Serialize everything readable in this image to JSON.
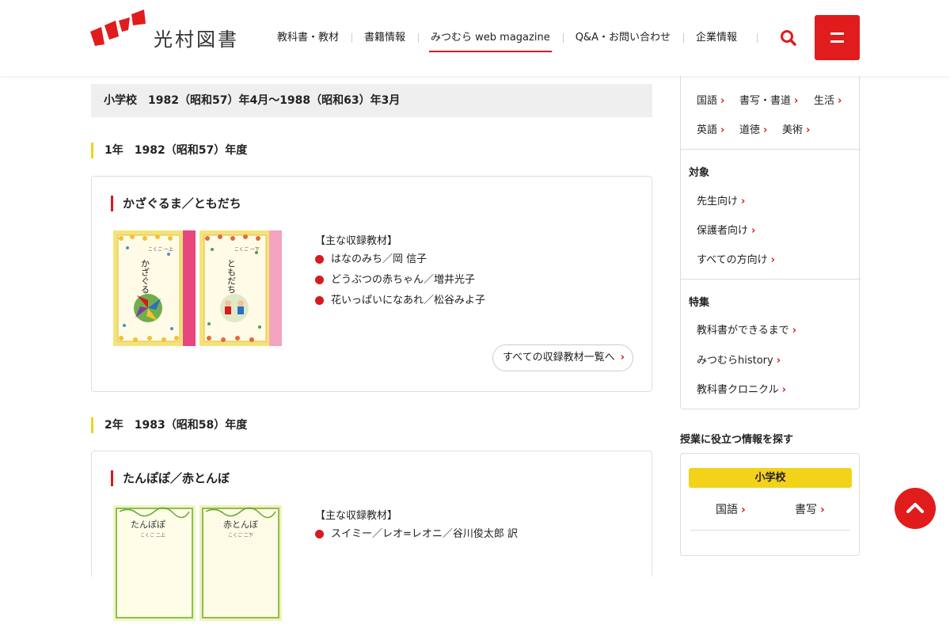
{
  "header": {
    "logo_text": "光村図書",
    "nav": [
      {
        "label": "教科書・教材"
      },
      {
        "label": "書籍情報"
      },
      {
        "label": "みつむら web magazine"
      },
      {
        "label": "Q&A・お問い合わせ"
      },
      {
        "label": "企業情報"
      }
    ],
    "brand_color": "#e01c1c"
  },
  "main": {
    "period_title": "小学校　1982（昭和57）年4月〜1988（昭和63）年3月",
    "years": [
      {
        "heading": "1年　1982（昭和57）年度",
        "card": {
          "title": "かざぐるま／ともだち",
          "books": [
            {
              "title": "かざぐるま",
              "grade_label": "こくご 一上",
              "accent": "#e9457e"
            },
            {
              "title": "ともだち",
              "grade_label": "こくご 一下",
              "accent": "#f4a3c0"
            }
          ],
          "contents_label": "【主な収録教材】",
          "contents": [
            "はなのみち／岡 信子",
            "どうぶつの赤ちゃん／増井光子",
            "花いっぱいになあれ／松谷みよ子"
          ],
          "all_button": "すべての収録教材一覧へ"
        }
      },
      {
        "heading": "2年　1983（昭和58）年度",
        "card": {
          "title": "たんぽぽ／赤とんぼ",
          "books": [
            {
              "title": "たんぽぽ",
              "grade_label": "こくご 二上"
            },
            {
              "title": "赤とんぼ",
              "grade_label": "こくご 二下"
            }
          ],
          "contents_label": "【主な収録教材】",
          "contents": [
            "スイミー／レオ=レオニ／谷川俊太郎 訳"
          ]
        }
      }
    ]
  },
  "sidebar": {
    "subjects_row1": [
      "国語",
      "書写・書道",
      "生活"
    ],
    "subjects_row2": [
      "英語",
      "道徳",
      "美術"
    ],
    "target_heading": "対象",
    "targets": [
      "先生向け",
      "保護者向け",
      "すべての方向け"
    ],
    "feature_heading": "特集",
    "features": [
      "教科書ができるまで",
      "みつむらhistory",
      "教科書クロニクル"
    ],
    "search_title": "授業に役立つ情報を探す",
    "level": "小学校",
    "level_subjects": [
      "国語",
      "書写"
    ]
  }
}
